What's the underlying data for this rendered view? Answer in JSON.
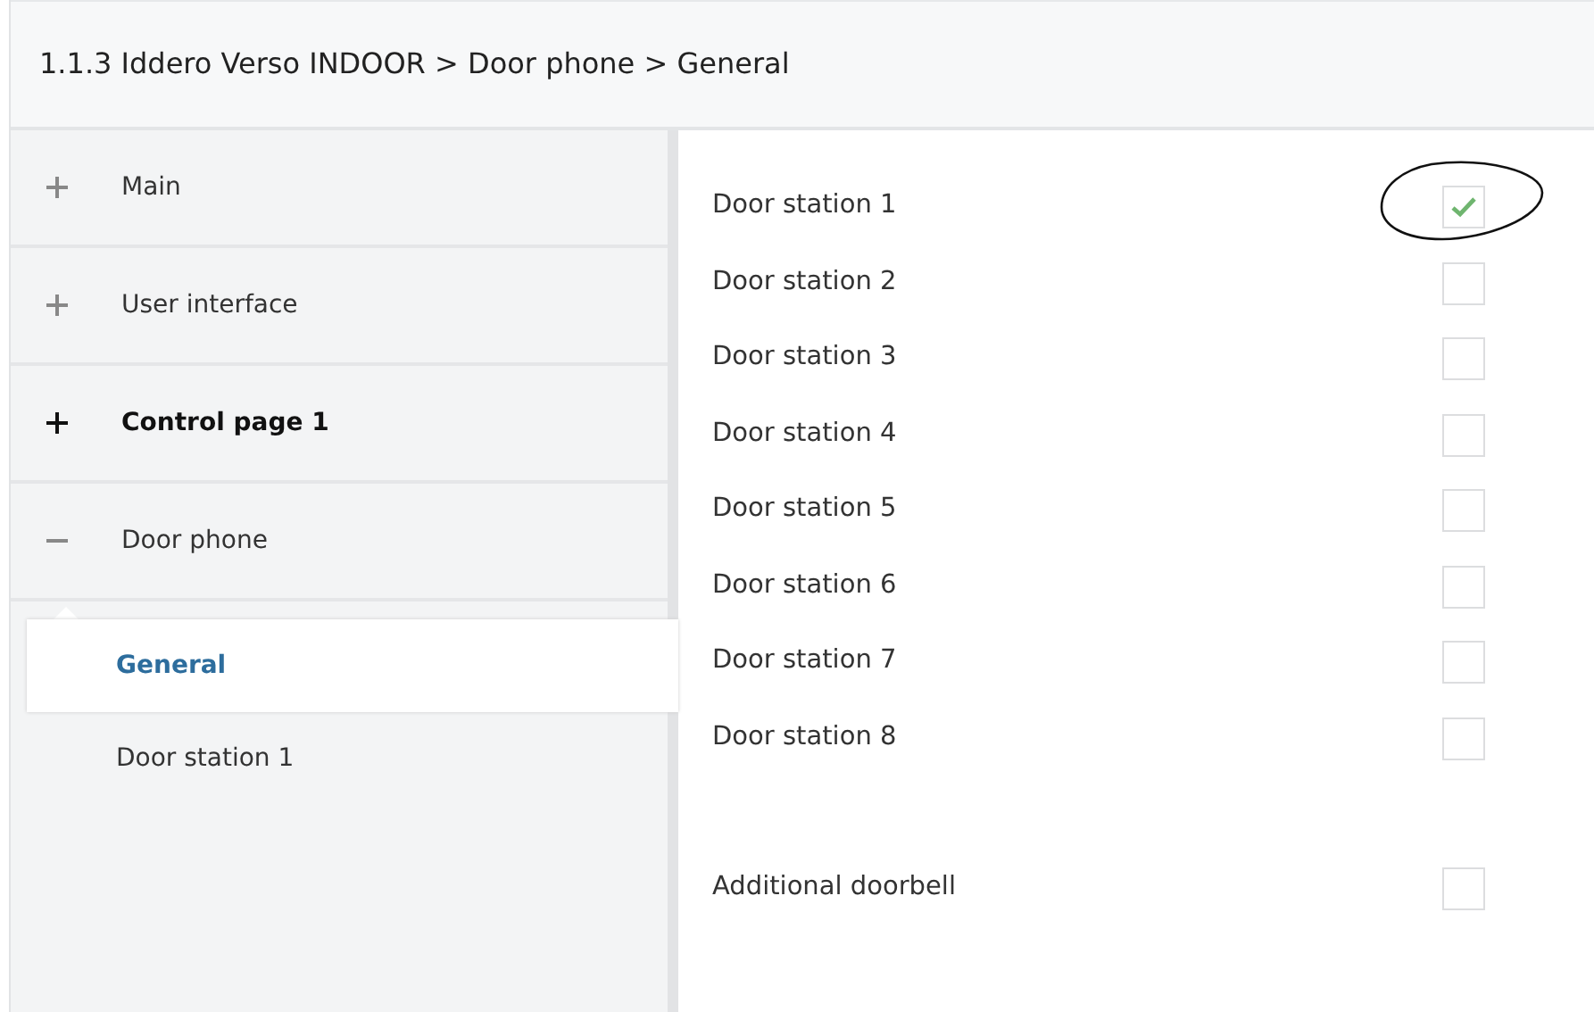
{
  "header": {
    "title": "1.1.3 Iddero Verso INDOOR > Door phone > General"
  },
  "sidebar": {
    "items": [
      {
        "label": "Main",
        "expanded": false,
        "highlighted": false
      },
      {
        "label": "User interface",
        "expanded": false,
        "highlighted": false
      },
      {
        "label": "Control page 1",
        "expanded": false,
        "highlighted": true
      },
      {
        "label": "Door phone",
        "expanded": true,
        "highlighted": false,
        "children": [
          {
            "label": "General",
            "selected": true
          },
          {
            "label": "Door station 1",
            "selected": false
          }
        ]
      }
    ]
  },
  "settings": {
    "door_stations": [
      {
        "label": "Door station 1",
        "checked": true
      },
      {
        "label": "Door station 2",
        "checked": false
      },
      {
        "label": "Door station 3",
        "checked": false
      },
      {
        "label": "Door station 4",
        "checked": false
      },
      {
        "label": "Door station 5",
        "checked": false
      },
      {
        "label": "Door station 6",
        "checked": false
      },
      {
        "label": "Door station 7",
        "checked": false
      },
      {
        "label": "Door station 8",
        "checked": false
      }
    ],
    "extras": [
      {
        "label": "Additional doorbell",
        "checked": false
      }
    ]
  }
}
